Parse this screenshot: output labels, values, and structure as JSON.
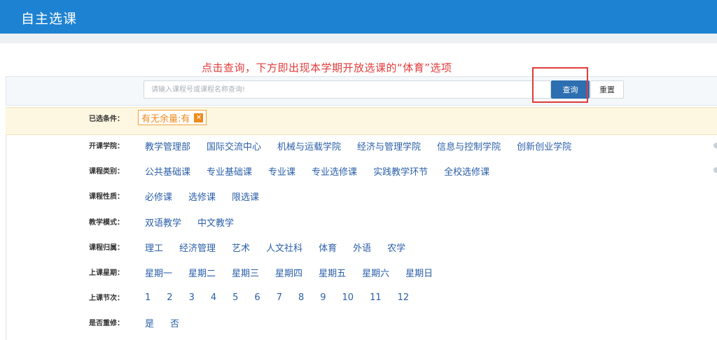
{
  "app": {
    "title": "自主选课"
  },
  "annotation": "点击查询，下方即出现本学期开放选课的“体育”选项",
  "search": {
    "placeholder": "请输入课程号或课程名称查询!",
    "value": "",
    "query_label": "查询",
    "reset_label": "重置"
  },
  "selected": {
    "label": "已选条件：",
    "chip_text": "有无余量:有",
    "chip_close": "✕"
  },
  "filters": [
    {
      "label": "开课学院：",
      "options": [
        "教学管理部",
        "国际交流中心",
        "机械与运载学院",
        "经济与管理学院",
        "信息与控制学院",
        "创新创业学院"
      ]
    },
    {
      "label": "课程类别：",
      "options": [
        "公共基础课",
        "专业基础课",
        "专业课",
        "专业选修课",
        "实践教学环节",
        "全校选修课"
      ]
    },
    {
      "label": "课程性质：",
      "options": [
        "必修课",
        "选修课",
        "限选课"
      ]
    },
    {
      "label": "教学模式：",
      "options": [
        "双语教学",
        "中文教学"
      ]
    },
    {
      "label": "课程归属：",
      "options": [
        "理工",
        "经济管理",
        "艺术",
        "人文社科",
        "体育",
        "外语",
        "农学"
      ]
    },
    {
      "label": "上课星期：",
      "options": [
        "星期一",
        "星期二",
        "星期三",
        "星期四",
        "星期五",
        "星期六",
        "星期日"
      ]
    },
    {
      "label": "上课节次：",
      "options": [
        "1",
        "2",
        "3",
        "4",
        "5",
        "6",
        "7",
        "8",
        "9",
        "10",
        "11",
        "12"
      ]
    },
    {
      "label": "是否重修：",
      "options": [
        "是",
        "否"
      ]
    }
  ],
  "colors": {
    "header": "#1e82d2",
    "link": "#2b5fa8",
    "annotation": "#e23b3b",
    "chip": "#f08a1c",
    "query_button": "#2d6fb1"
  }
}
